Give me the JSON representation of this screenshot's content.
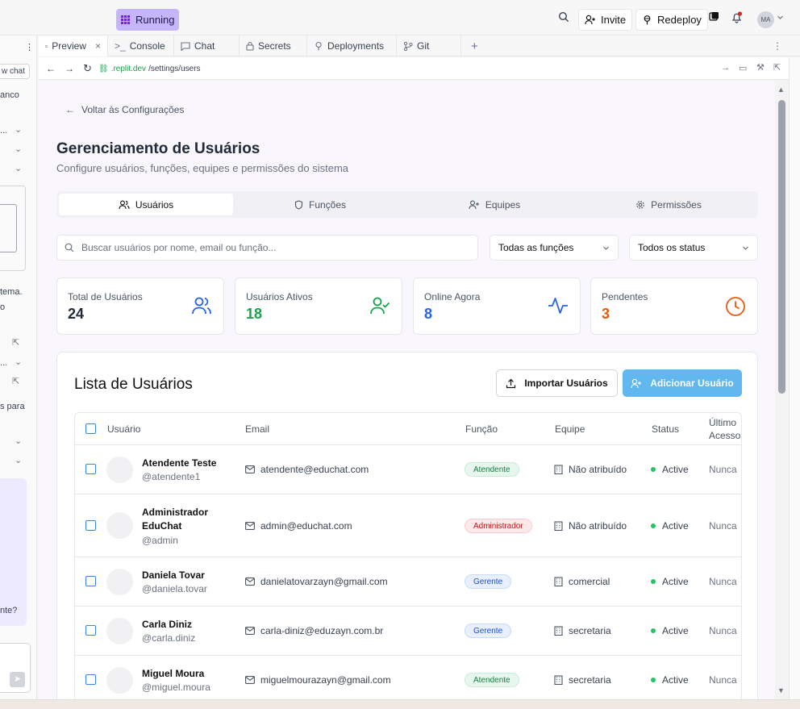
{
  "topbar": {
    "running_label": "Running",
    "invite_label": "Invite",
    "redeploy_label": "Redeploy",
    "avatar_initials": "MA"
  },
  "left_panel": {
    "snippets": [
      "w chat",
      "anco",
      "...",
      "tema.",
      "o",
      "...",
      "s para",
      "nte?"
    ]
  },
  "tabs": [
    {
      "label": "Preview",
      "active": true
    },
    {
      "label": "Console"
    },
    {
      "label": "Chat"
    },
    {
      "label": "Secrets"
    },
    {
      "label": "Deployments"
    },
    {
      "label": "Git"
    }
  ],
  "url": {
    "domain": ".replit.dev",
    "path": "/settings/users"
  },
  "page": {
    "back_label": "Voltar às Configurações",
    "title": "Gerenciamento de Usuários",
    "subtitle": "Configure usuários, funções, equipes e permissões do sistema",
    "segments": [
      {
        "label": "Usuários",
        "icon": "users-icon",
        "active": true
      },
      {
        "label": "Funções",
        "icon": "shield-icon"
      },
      {
        "label": "Equipes",
        "icon": "user-plus-icon"
      },
      {
        "label": "Permissões",
        "icon": "gear-icon"
      }
    ],
    "search_placeholder": "Buscar usuários por nome, email ou função...",
    "filter_role": "Todas as funções",
    "filter_status": "Todos os status"
  },
  "stats": [
    {
      "label": "Total de Usuários",
      "value": "24",
      "color": "#1f2937",
      "icon": "users-icon",
      "icon_color": "#2563eb"
    },
    {
      "label": "Usuários Ativos",
      "value": "18",
      "color": "#16a34a",
      "icon": "user-check-icon",
      "icon_color": "#16a34a"
    },
    {
      "label": "Online Agora",
      "value": "8",
      "color": "#2563eb",
      "icon": "activity-icon",
      "icon_color": "#2563eb"
    },
    {
      "label": "Pendentes",
      "value": "3",
      "color": "#ea580c",
      "icon": "clock-icon",
      "icon_color": "#ea580c"
    }
  ],
  "list": {
    "title": "Lista de Usuários",
    "import_label": "Importar Usuários",
    "add_label": "Adicionar Usuário",
    "columns": {
      "user": "Usuário",
      "email": "Email",
      "role": "Função",
      "team": "Equipe",
      "status": "Status",
      "last_access": "Último Acesso"
    },
    "rows": [
      {
        "name": "Atendente Teste",
        "username": "@atendente1",
        "email": "atendente@educhat.com",
        "role": "Atendente",
        "team": "Não atribuído",
        "status": "Active",
        "last_access": "Nunca"
      },
      {
        "name": "Administrador EduChat",
        "username": "@admin",
        "email": "admin@educhat.com",
        "role": "Administrador",
        "team": "Não atribuído",
        "status": "Active",
        "last_access": "Nunca"
      },
      {
        "name": "Daniela Tovar",
        "username": "@daniela.tovar",
        "email": "danielatovarzayn@gmail.com",
        "role": "Gerente",
        "team": "comercial",
        "status": "Active",
        "last_access": "Nunca"
      },
      {
        "name": "Carla Diniz",
        "username": "@carla.diniz",
        "email": "carla-diniz@eduzayn.com.br",
        "role": "Gerente",
        "team": "secretaria",
        "status": "Active",
        "last_access": "Nunca"
      },
      {
        "name": "Miguel Moura",
        "username": "@miguel.moura",
        "email": "miguelmourazayn@gmail.com",
        "role": "Atendente",
        "team": "secretaria",
        "status": "Active",
        "last_access": "Nunca"
      }
    ]
  }
}
